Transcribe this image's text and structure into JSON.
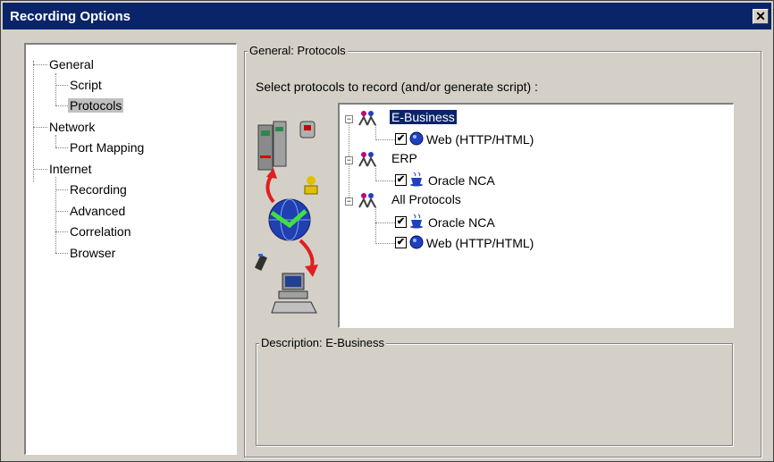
{
  "window": {
    "title": "Recording Options",
    "close_glyph": "✕"
  },
  "nav_tree": {
    "items": [
      {
        "label": "General"
      },
      {
        "label": "Script"
      },
      {
        "label": "Protocols"
      },
      {
        "label": "Network"
      },
      {
        "label": "Port Mapping"
      },
      {
        "label": "Internet"
      },
      {
        "label": "Recording"
      },
      {
        "label": "Advanced"
      },
      {
        "label": "Correlation"
      },
      {
        "label": "Browser"
      }
    ],
    "selected": "Protocols"
  },
  "panel": {
    "group_title": "General: Protocols",
    "prompt": "Select protocols to record (and/or generate script) :",
    "description_title": "Description: E-Business"
  },
  "protocol_tree": {
    "groups": [
      {
        "label": "E-Business",
        "expander": "−",
        "children": [
          {
            "label": "Web (HTTP/HTML)",
            "checked": "✔"
          }
        ]
      },
      {
        "label": "ERP",
        "expander": "−",
        "children": [
          {
            "label": "Oracle NCA",
            "checked": "✔"
          }
        ]
      },
      {
        "label": "All Protocols",
        "expander": "−",
        "children": [
          {
            "label": "Oracle NCA",
            "checked": "✔"
          },
          {
            "label": "Web (HTTP/HTML)",
            "checked": "✔"
          }
        ]
      }
    ],
    "selected": "E-Business"
  },
  "colors": {
    "titlebar": "#0a246a",
    "face": "#d4d0c8",
    "selection": "#0a246a"
  }
}
